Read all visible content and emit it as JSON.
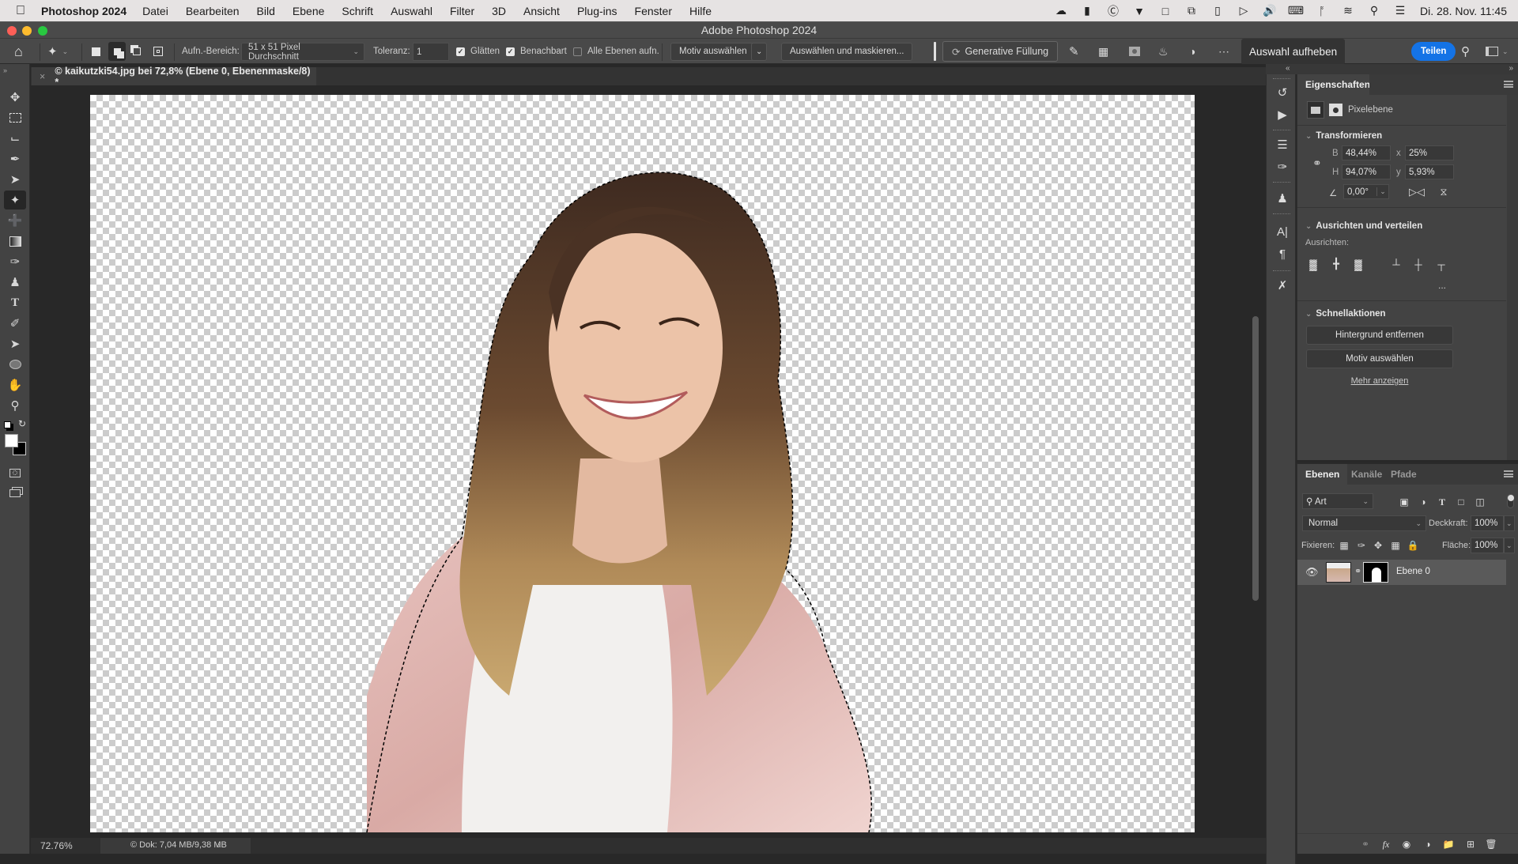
{
  "menubar": {
    "app_name": "Photoshop 2024",
    "items": [
      "Datei",
      "Bearbeiten",
      "Bild",
      "Ebene",
      "Schrift",
      "Auswahl",
      "Filter",
      "3D",
      "Ansicht",
      "Plug-ins",
      "Fenster",
      "Hilfe"
    ],
    "status_icons": [
      "creative-cloud-icon",
      "battery-monitor-icon",
      "accessibility-icon",
      "brush-tray-icon",
      "display-icon",
      "screen-mirroring-icon",
      "phone-icon",
      "play-icon",
      "volume-icon",
      "keyboard-input-icon",
      "bluetooth-icon",
      "wifi-icon",
      "spotlight-search-icon",
      "control-center-icon"
    ],
    "clock": "Di. 28. Nov.  11:45"
  },
  "window": {
    "title": "Adobe Photoshop 2024"
  },
  "options_bar": {
    "sample_size_label": "Aufn.-Bereich:",
    "sample_size_value": "51 x 51 Pixel Durchschnitt",
    "tolerance_label": "Toleranz:",
    "tolerance_value": "1",
    "antialias_label": "Glätten",
    "antialias_checked": true,
    "contiguous_label": "Benachbart",
    "contiguous_checked": true,
    "sample_all_label": "Alle Ebenen aufn.",
    "sample_all_checked": false,
    "select_subject_label": "Motiv auswählen",
    "select_mask_label": "Auswählen und maskieren...",
    "generative_fill_label": "Generative Füllung",
    "deselect_label": "Auswahl aufheben",
    "share_label": "Teilen",
    "share_color": "#1473e6"
  },
  "document": {
    "tab_title": "© kaikutzki54.jpg bei 72,8% (Ebene 0, Ebenenmaske/8) *",
    "zoom": "72.76%",
    "doc_size": "© Dok: 7,04 MB/9,38 MB"
  },
  "tools": [
    "move",
    "rectangular-marquee",
    "crop",
    "eyedropper",
    "lasso",
    "magic-wand",
    "healing-brush",
    "gradient",
    "brush",
    "clone-stamp",
    "type",
    "pen",
    "path-selection",
    "ellipse",
    "hand",
    "zoom"
  ],
  "active_tool": "magic-wand",
  "properties": {
    "tab": "Eigenschaften",
    "layer_type": "Pixelebene",
    "transform": {
      "title": "Transformieren",
      "w_label": "B",
      "w_value": "48,44%",
      "h_label": "H",
      "h_value": "94,07%",
      "x_label": "x",
      "x_value": "25%",
      "y_label": "y",
      "y_value": "5,93%",
      "angle_value": "0,00°"
    },
    "align": {
      "title": "Ausrichten und verteilen",
      "sub": "Ausrichten:",
      "more": "..."
    },
    "quick_actions": {
      "title": "Schnellaktionen",
      "remove_bg": "Hintergrund entfernen",
      "select_subject": "Motiv auswählen",
      "more": "Mehr anzeigen"
    }
  },
  "layers_panel": {
    "tabs": [
      "Ebenen",
      "Kanäle",
      "Pfade"
    ],
    "active_tab": "Ebenen",
    "filter_value": "Art",
    "blend_mode": "Normal",
    "opacity_label": "Deckkraft:",
    "opacity_value": "100%",
    "lock_label": "Fixieren:",
    "fill_label": "Fläche:",
    "fill_value": "100%",
    "layers": [
      {
        "name": "Ebene 0",
        "visible": true,
        "has_mask": true
      }
    ]
  }
}
